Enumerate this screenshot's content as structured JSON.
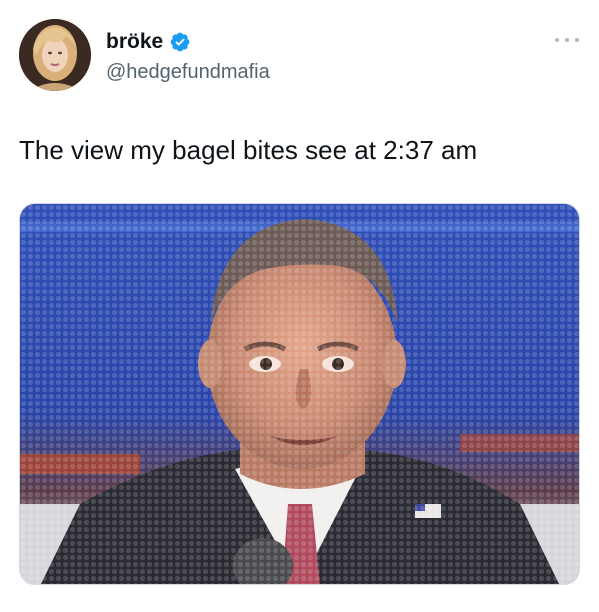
{
  "author": {
    "display_name": "bröke",
    "handle": "@hedgefundmafia",
    "verified": true,
    "avatar_icon": "profile-photo",
    "verified_icon": "verified-badge-icon",
    "more_icon": "more-options-icon"
  },
  "tweet": {
    "text": "The view my bagel bites see at 2:37 am"
  },
  "media": {
    "icon": "photo-man-in-suit-halftone"
  },
  "colors": {
    "text_primary": "#0f1419",
    "text_secondary": "#536471",
    "verified_blue": "#1d9bf0",
    "media_border": "#cfd9de"
  }
}
